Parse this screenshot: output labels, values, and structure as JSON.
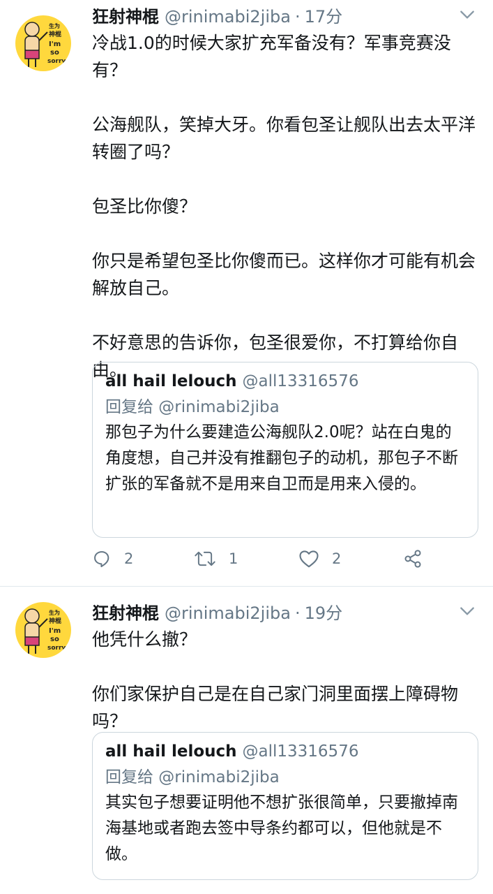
{
  "colors": {
    "text": "#14171a",
    "muted": "#657786",
    "border": "#ccd6dd",
    "avatar_bg": "#ffd83d"
  },
  "tweets": [
    {
      "name": "狂射神棍",
      "handle": "@rinimabi2jiba",
      "dot": "·",
      "time": "17分",
      "paragraphs": [
        "冷战1.0的时候大家扩充军备没有？军事竞赛没有？",
        "公海舰队，笑掉大牙。你看包圣让舰队出去太平洋转圈了吗？",
        "包圣比你傻？",
        "你只是希望包圣比你傻而已。这样你才可能有机会解放自己。",
        "不好意思的告诉你，包圣很爱你，不打算给你自由。"
      ],
      "quote": {
        "name": "all hail lelouch",
        "handle": "@all13316576",
        "reply": "回复给 @rinimabi2jiba",
        "text": "那包子为什么要建造公海舰队2.0呢？站在白鬼的角度想，自己并没有推翻包子的动机，那包子不断扩张的军备就不是用来自卫而是用来入侵的。"
      },
      "actions": {
        "replies": "2",
        "retweets": "1",
        "likes": "2"
      }
    },
    {
      "name": "狂射神棍",
      "handle": "@rinimabi2jiba",
      "dot": "·",
      "time": "19分",
      "paragraphs": [
        "他凭什么撤？",
        "你们家保护自己是在自己家门洞里面摆上障碍物吗？"
      ],
      "quote": {
        "name": "all hail lelouch",
        "handle": "@all13316576",
        "reply": "回复给 @rinimabi2jiba",
        "text": "其实包子想要证明他不想扩张很简单，只要撤掉南海基地或者跑去签中导条约都可以，但他就是不做。"
      }
    }
  ],
  "avatar_text": [
    "生为",
    "神棍",
    "I'm",
    "so",
    "sorry"
  ]
}
